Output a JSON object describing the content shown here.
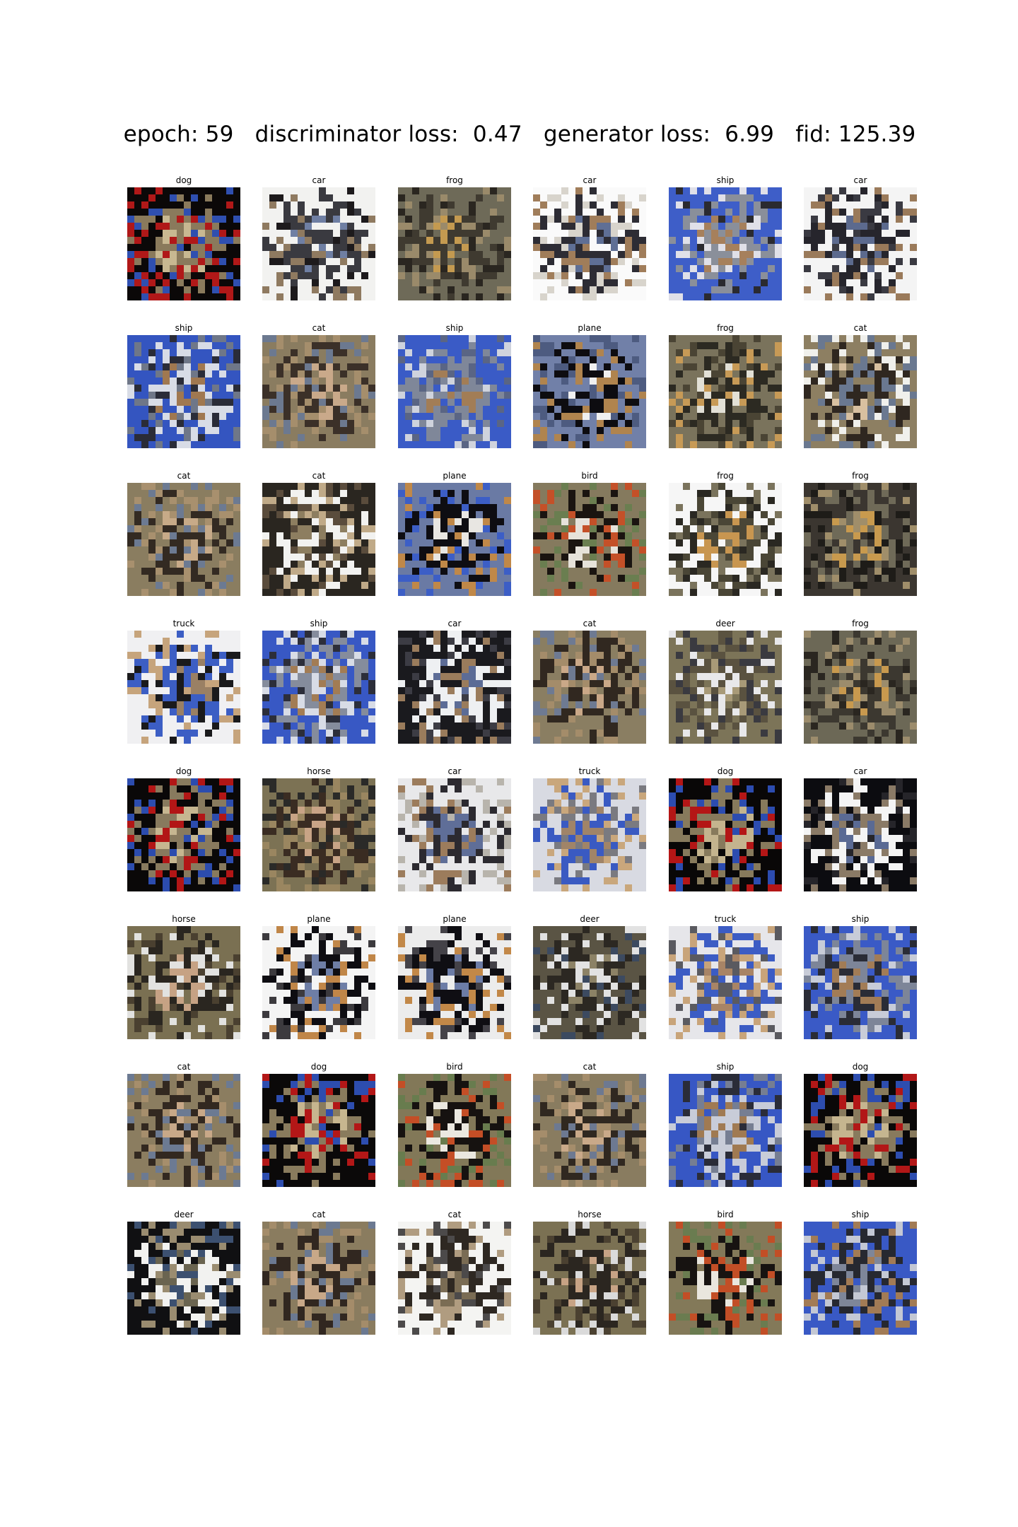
{
  "figure": {
    "title": "epoch: 59   discriminator loss:  0.47   generator loss:  6.99   fid: 125.39",
    "grid": {
      "rows": 8,
      "cols": 6
    },
    "samples": [
      {
        "label": "dog",
        "palette": [
          "#0b0808",
          "#8a7a5c",
          "#c8b891",
          "#b01818",
          "#2f4fb0"
        ]
      },
      {
        "label": "car",
        "palette": [
          "#f2f2f0",
          "#3a3a40",
          "#6f7fa3",
          "#8f7a60",
          "#1d1a1c"
        ]
      },
      {
        "label": "frog",
        "palette": [
          "#6e6a58",
          "#3f3a30",
          "#c49a50",
          "#9a8a6a",
          "#2a2620"
        ]
      },
      {
        "label": "car",
        "palette": [
          "#fafafa",
          "#2d2c34",
          "#5f6f95",
          "#a07d5a",
          "#d8d4cc"
        ]
      },
      {
        "label": "ship",
        "palette": [
          "#3e5ec8",
          "#8a8f9a",
          "#a6805c",
          "#e0e0e8",
          "#2a2a30"
        ]
      },
      {
        "label": "car",
        "palette": [
          "#f4f4f4",
          "#26252c",
          "#5c6a8e",
          "#9a7a5a",
          "#3a3a42"
        ]
      },
      {
        "label": "ship",
        "palette": [
          "#3455c0",
          "#d8dce6",
          "#a07850",
          "#6f7788",
          "#2a2c38"
        ]
      },
      {
        "label": "cat",
        "palette": [
          "#8a7c60",
          "#3b3028",
          "#c9a98a",
          "#6c7990",
          "#a58e6c"
        ]
      },
      {
        "label": "ship",
        "palette": [
          "#3a5bc6",
          "#7f8799",
          "#a27d56",
          "#5a6584",
          "#cfd3dd"
        ]
      },
      {
        "label": "plane",
        "palette": [
          "#7180a8",
          "#0d0c10",
          "#f0f0f0",
          "#b0844e",
          "#4d5b80"
        ]
      },
      {
        "label": "frog",
        "palette": [
          "#7a735c",
          "#2c2a22",
          "#e2e0d6",
          "#c79a56",
          "#4a4434"
        ]
      },
      {
        "label": "cat",
        "palette": [
          "#8d7f62",
          "#2f2720",
          "#d8c0a0",
          "#6a7890",
          "#f0f0ec"
        ]
      },
      {
        "label": "cat",
        "palette": [
          "#8a7d60",
          "#332a22",
          "#c7aa88",
          "#6c7a92",
          "#a8906e"
        ]
      },
      {
        "label": "cat",
        "palette": [
          "#2a2620",
          "#f2f2f0",
          "#8d7e60",
          "#5a4c3c",
          "#c0aa88"
        ]
      },
      {
        "label": "plane",
        "palette": [
          "#6a7aa4",
          "#0e0d12",
          "#e8e6e2",
          "#c08848",
          "#3c5ec6"
        ]
      },
      {
        "label": "bird",
        "palette": [
          "#857a5e",
          "#1a1410",
          "#e6e2da",
          "#c45028",
          "#6a7e50"
        ]
      },
      {
        "label": "frog",
        "palette": [
          "#f6f6f6",
          "#4a4636",
          "#c89650",
          "#7a735c",
          "#2a2822"
        ]
      },
      {
        "label": "frog",
        "palette": [
          "#3b3630",
          "#6f6a58",
          "#c89a4e",
          "#a08e6a",
          "#1e1c18"
        ]
      },
      {
        "label": "truck",
        "palette": [
          "#f0f0f2",
          "#3c5ec4",
          "#9a8064",
          "#1a1a1c",
          "#c6a47c"
        ]
      },
      {
        "label": "ship",
        "palette": [
          "#3858c4",
          "#858c9c",
          "#a27c54",
          "#d8dce6",
          "#2c2e3a"
        ]
      },
      {
        "label": "car",
        "palette": [
          "#1a1a1e",
          "#eef0f2",
          "#5c6c96",
          "#9a7c5c",
          "#3c3c44"
        ]
      },
      {
        "label": "cat",
        "palette": [
          "#8a7e62",
          "#312820",
          "#caa888",
          "#6e7a92",
          "#a48c6a"
        ]
      },
      {
        "label": "deer",
        "palette": [
          "#7c7458",
          "#5a5240",
          "#a89a78",
          "#e8e8ea",
          "#3a3a40"
        ]
      },
      {
        "label": "frog",
        "palette": [
          "#6c6856",
          "#3c3830",
          "#c8994e",
          "#9c8c6c",
          "#2a2620"
        ]
      },
      {
        "label": "dog",
        "palette": [
          "#0a0808",
          "#887a5e",
          "#c6b690",
          "#b21616",
          "#2c4cae"
        ]
      },
      {
        "label": "horse",
        "palette": [
          "#7c7254",
          "#3a2c22",
          "#c8a486",
          "#9a8660",
          "#2a2a28"
        ]
      },
      {
        "label": "car",
        "palette": [
          "#e8e8ea",
          "#2c2a30",
          "#5f6e98",
          "#9c7c5c",
          "#b8b4ac"
        ]
      },
      {
        "label": "truck",
        "palette": [
          "#d8dae2",
          "#3a5ac2",
          "#a08468",
          "#7a7a80",
          "#c9a77c"
        ]
      },
      {
        "label": "dog",
        "palette": [
          "#090707",
          "#877a5c",
          "#c4b48e",
          "#b41616",
          "#2c4cb0"
        ]
      },
      {
        "label": "car",
        "palette": [
          "#0c0c10",
          "#f4f4f4",
          "#5a6a94",
          "#8a7a66",
          "#26252a"
        ]
      },
      {
        "label": "horse",
        "palette": [
          "#7a7052",
          "#2a2620",
          "#c6a284",
          "#e2e2e0",
          "#4a4030"
        ]
      },
      {
        "label": "plane",
        "palette": [
          "#f4f4f4",
          "#0e0d12",
          "#6e7ea6",
          "#c08648",
          "#3c3a3e"
        ]
      },
      {
        "label": "plane",
        "palette": [
          "#ececec",
          "#0f0e13",
          "#6c7ca6",
          "#c28848",
          "#444248"
        ]
      },
      {
        "label": "deer",
        "palette": [
          "#5a5444",
          "#2c2822",
          "#8c8266",
          "#e2e2e2",
          "#3c4a60"
        ]
      },
      {
        "label": "truck",
        "palette": [
          "#e6e6ea",
          "#3c5cc4",
          "#a88466",
          "#5a5a60",
          "#c8a47a"
        ]
      },
      {
        "label": "ship",
        "palette": [
          "#3a5ac6",
          "#7d8598",
          "#a27c56",
          "#2a2c36",
          "#c8ccd8"
        ]
      },
      {
        "label": "cat",
        "palette": [
          "#8b7d60",
          "#322820",
          "#c8a888",
          "#6c7a92",
          "#a68e6c"
        ]
      },
      {
        "label": "dog",
        "palette": [
          "#0b0909",
          "#897b5d",
          "#c7b68f",
          "#b31717",
          "#2d4daf"
        ]
      },
      {
        "label": "bird",
        "palette": [
          "#827858",
          "#161210",
          "#ebe8e0",
          "#c44e26",
          "#687c4e"
        ]
      },
      {
        "label": "cat",
        "palette": [
          "#897c60",
          "#302820",
          "#c9a989",
          "#6d7991",
          "#a58d6b"
        ]
      },
      {
        "label": "ship",
        "palette": [
          "#3757c4",
          "#c8ccd8",
          "#a07a52",
          "#767e92",
          "#2a2c38"
        ]
      },
      {
        "label": "dog",
        "palette": [
          "#0a0808",
          "#887a5d",
          "#c5b58f",
          "#b21717",
          "#2d4daf"
        ]
      },
      {
        "label": "deer",
        "palette": [
          "#101012",
          "#f2f2f0",
          "#6a6450",
          "#3c5070",
          "#9a8c70"
        ]
      },
      {
        "label": "cat",
        "palette": [
          "#8a7c5f",
          "#312720",
          "#c8a888",
          "#6b7991",
          "#a48c6a"
        ]
      },
      {
        "label": "cat",
        "palette": [
          "#f4f4f2",
          "#2e2822",
          "#7a6c54",
          "#4c4a4a",
          "#b09c80"
        ]
      },
      {
        "label": "horse",
        "palette": [
          "#7b7153",
          "#2b2620",
          "#c7a385",
          "#dadada",
          "#4b4131"
        ]
      },
      {
        "label": "bird",
        "palette": [
          "#837959",
          "#171311",
          "#e9e6de",
          "#c24e26",
          "#6a7c50"
        ]
      },
      {
        "label": "ship",
        "palette": [
          "#3959c5",
          "#262830",
          "#7e8699",
          "#a27b55",
          "#c4c8d4"
        ]
      }
    ]
  }
}
